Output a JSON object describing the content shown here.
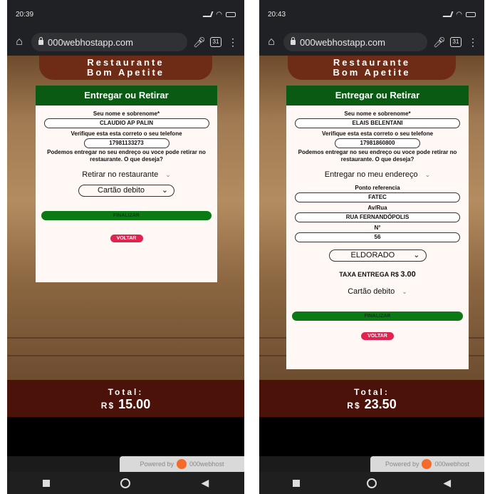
{
  "left": {
    "status_time": "20:39",
    "url": "000webhostapp.com",
    "tab_count": "31",
    "brand_line1": "Restaurante",
    "brand_line2": "Bom Apetite",
    "card_title": "Entregar ou Retirar",
    "name_label": "Seu nome e sobrenome*",
    "name_value": "CLAUDIO AP PALIN",
    "phone_label": "Verifique esta esta correto o seu telefone",
    "phone_value": "17981133273",
    "question": "Podemos entregar no seu endreço ou voce pode retirar no restaurante. O que deseja?",
    "delivery_option": "Retirar no restaurante",
    "payment": "Cartão debito",
    "finalize": "FINALIZAR",
    "back": "VOLTAR",
    "total_label": "Total:",
    "total_currency": "R$",
    "total_value": "15.00"
  },
  "right": {
    "status_time": "20:43",
    "url": "000webhostapp.com",
    "tab_count": "31",
    "brand_line1": "Restaurante",
    "brand_line2": "Bom Apetite",
    "card_title": "Entregar ou Retirar",
    "name_label": "Seu nome e sobrenome*",
    "name_value": "ELAIS BELENTANI",
    "phone_label": "Verifique esta esta correto o seu telefone",
    "phone_value": "17981860800",
    "question": "Podemos entregar no seu endreço ou voce pode retirar no restaurante. O que deseja?",
    "delivery_option": "Entregar no meu endereço",
    "ref_label": "Ponto referencia",
    "ref_value": "FATEC",
    "street_label": "Av/Rua",
    "street_value": "RUA FERNANDÓPOLIS",
    "number_label": "N°",
    "number_value": "56",
    "neighborhood": "ELDORADO",
    "fee_label": "TAXA ENTREGA R$",
    "fee_value": "3.00",
    "payment": "Cartão debito",
    "finalize": "FINALIZAR",
    "back": "VOLTAR",
    "total_label": "Total:",
    "total_currency": "R$",
    "total_value": "23.50"
  },
  "powered_by": "Powered by",
  "powered_brand": "000webhost",
  "colors": {
    "header_green": "#0b5a14",
    "finalize_green": "#0b7a15",
    "back_red": "#e0234f",
    "total_bg": "#4a1208"
  }
}
